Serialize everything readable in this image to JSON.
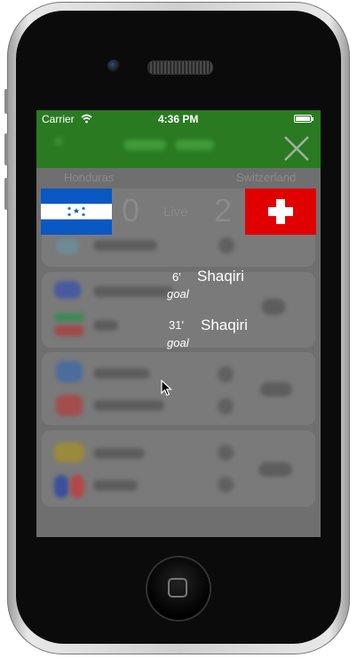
{
  "status_bar": {
    "carrier": "Carrier",
    "time": "4:36 PM"
  },
  "match": {
    "home_team": "Honduras",
    "away_team": "Switzerland",
    "home_score": "0",
    "away_score": "2",
    "status": "Live"
  },
  "events": [
    {
      "minute": "6'",
      "player": "Shaqiri",
      "type": "goal"
    },
    {
      "minute": "31'",
      "player": "Shaqiri",
      "type": "goal"
    }
  ],
  "icons": [
    "wifi-icon",
    "battery-icon",
    "close-icon",
    "honduras-flag-icon",
    "switzerland-flag-icon",
    "cursor-icon"
  ],
  "colors": {
    "navbar": "#2a7a22",
    "overlay": "#717171",
    "swiss_red": "#e10000",
    "honduras_blue": "#0a58c4"
  }
}
